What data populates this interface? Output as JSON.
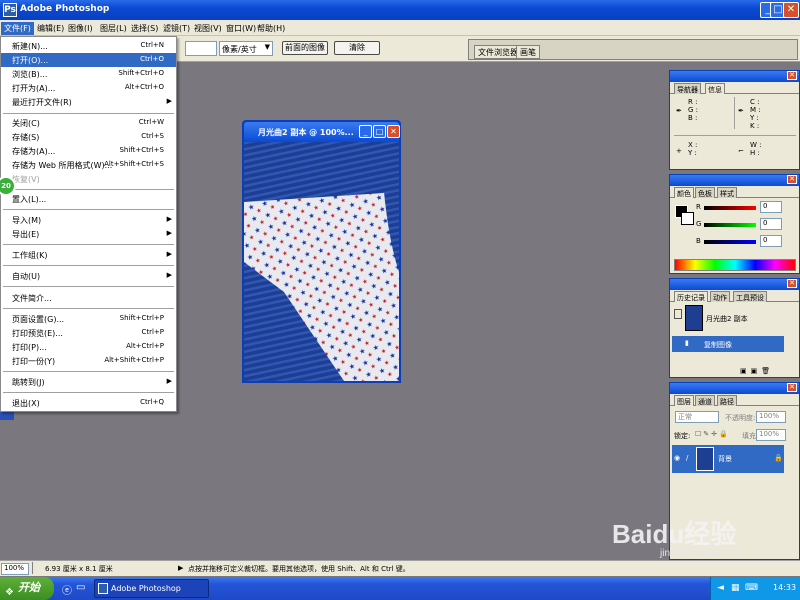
{
  "window": {
    "title": "Adobe Photoshop"
  },
  "menubar": {
    "items": [
      "文件(F)",
      "编辑(E)",
      "图像(I)",
      "图层(L)",
      "选择(S)",
      "滤镜(T)",
      "视图(V)",
      "窗口(W)",
      "帮助(H)"
    ]
  },
  "options": {
    "resolution_unit": "像素/英寸",
    "front_image_button": "前面的图像",
    "clear_button": "清除"
  },
  "palette_well": {
    "tabs": [
      "文件浏览器",
      "画笔"
    ]
  },
  "file_menu": {
    "items": [
      {
        "label": "新建(N)...",
        "shortcut": "Ctrl+N"
      },
      {
        "label": "打开(O)...",
        "shortcut": "Ctrl+O"
      },
      {
        "label": "浏览(B)...",
        "shortcut": "Shift+Ctrl+O"
      },
      {
        "label": "打开为(A)...",
        "shortcut": "Alt+Ctrl+O"
      },
      {
        "label": "最近打开文件(R)",
        "shortcut": ""
      },
      {
        "label": "关闭(C)",
        "shortcut": "Ctrl+W"
      },
      {
        "label": "存储(S)",
        "shortcut": "Ctrl+S"
      },
      {
        "label": "存储为(A)...",
        "shortcut": "Shift+Ctrl+S"
      },
      {
        "label": "存储为 Web 所用格式(W)...",
        "shortcut": "Alt+Shift+Ctrl+S"
      },
      {
        "label": "恢复(V)",
        "shortcut": ""
      },
      {
        "label": "置入(L)...",
        "shortcut": ""
      },
      {
        "label": "导入(M)",
        "shortcut": ""
      },
      {
        "label": "导出(E)",
        "shortcut": ""
      },
      {
        "label": "工作组(K)",
        "shortcut": ""
      },
      {
        "label": "自动(U)",
        "shortcut": ""
      },
      {
        "label": "文件简介...",
        "shortcut": ""
      },
      {
        "label": "页面设置(G)...",
        "shortcut": "Shift+Ctrl+P"
      },
      {
        "label": "打印预览(E)...",
        "shortcut": "Ctrl+P"
      },
      {
        "label": "打印(P)...",
        "shortcut": "Alt+Ctrl+P"
      },
      {
        "label": "打印一份(Y)",
        "shortcut": "Alt+Shift+Ctrl+P"
      },
      {
        "label": "跳转到(J)",
        "shortcut": ""
      },
      {
        "label": "退出(X)",
        "shortcut": "Ctrl+Q"
      }
    ]
  },
  "document": {
    "title": "月光曲2 副本 @ 100%..."
  },
  "navigator": {
    "tabs": [
      "导航器",
      "信息"
    ],
    "rgb": [
      "R :",
      "G :",
      "B :"
    ],
    "cmyk": [
      "C :",
      "M :",
      "Y :",
      "K :"
    ],
    "xy": [
      "X :",
      "Y :"
    ],
    "wh": [
      "W :",
      "H :"
    ]
  },
  "color": {
    "tabs": [
      "颜色",
      "色板",
      "样式"
    ],
    "channels": [
      {
        "label": "R",
        "value": "0"
      },
      {
        "label": "G",
        "value": "0"
      },
      {
        "label": "B",
        "value": "0"
      }
    ]
  },
  "history": {
    "tabs": [
      "历史记录",
      "动作",
      "工具预设"
    ],
    "snapshot": "月光曲2 副本",
    "step": "复制图像"
  },
  "layers": {
    "tabs": [
      "图层",
      "通道",
      "路径"
    ],
    "blend_mode": "正常",
    "opacity_label": "不透明度:",
    "opacity_value": "100%",
    "lock_label": "锁定:",
    "fill_label": "填充:",
    "fill_value": "100%",
    "layer_name": "背景"
  },
  "status": {
    "zoom": "100%",
    "doc_size": "6.93 厘米 x 8.1 厘米",
    "hint": "点按并拖移可定义裁切框。要用其他选项，使用 Shift、Alt 和 Ctrl 键。"
  },
  "taskbar": {
    "start": "开始",
    "task": "Adobe Photoshop",
    "clock": "14:33"
  },
  "watermark": {
    "brand": "Baidu经验",
    "url": "jingyan.baidu.com"
  },
  "badge": {
    "text": "20"
  },
  "colors": {
    "accent": "#316ac5",
    "title_blue": "#0a4ad4",
    "workspace": "#7a777f"
  }
}
